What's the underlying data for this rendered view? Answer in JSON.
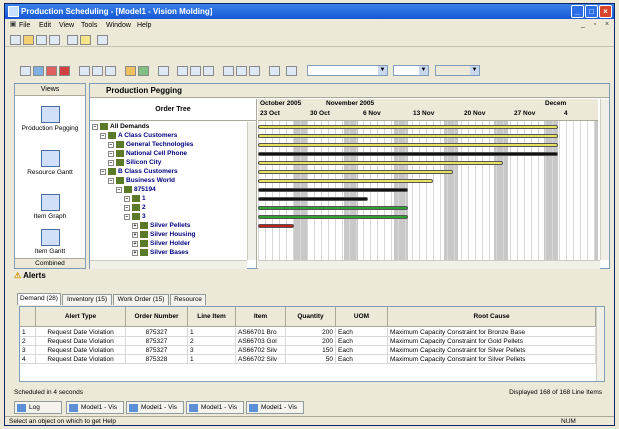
{
  "window": {
    "title": "Production Scheduling - [Model1 - Vision Molding]"
  },
  "menu": [
    "File",
    "Edit",
    "View",
    "Tools",
    "Window",
    "Help"
  ],
  "views": {
    "header": "Views",
    "items": [
      "Production Pegging",
      "Resource Gantt",
      "Item Graph",
      "Item Gantt"
    ],
    "footer": "Combined"
  },
  "pegging": {
    "title": "Production Pegging",
    "tree_header": "Order Tree",
    "tree": [
      {
        "label": "All Demands",
        "level": 0
      },
      {
        "label": "A Class Customers",
        "level": 1
      },
      {
        "label": "General Technologies",
        "level": 2
      },
      {
        "label": "National Cell Phone",
        "level": 2
      },
      {
        "label": "Silicon City",
        "level": 2
      },
      {
        "label": "B Class Customers",
        "level": 1
      },
      {
        "label": "Business World",
        "level": 2
      },
      {
        "label": "875194",
        "level": 3
      },
      {
        "label": "1",
        "level": 4
      },
      {
        "label": "2",
        "level": 4
      },
      {
        "label": "3",
        "level": 4
      },
      {
        "label": "Silver Pellets",
        "level": 5
      },
      {
        "label": "Silver Housing",
        "level": 5
      },
      {
        "label": "Silver Holder",
        "level": 5
      },
      {
        "label": "Silver Bases",
        "level": 5
      }
    ],
    "months": [
      "October 2005",
      "November 2005",
      "Decem"
    ],
    "weeks": [
      "23 Oct",
      "30 Oct",
      "6 Nov",
      "13 Nov",
      "20 Nov",
      "27 Nov",
      "4"
    ]
  },
  "alerts": {
    "title": "Alerts",
    "tabs": [
      "Demand (28)",
      "Inventory (15)",
      "Work Order (15)",
      "Resource"
    ],
    "columns": [
      "Alert Type",
      "Order Number",
      "Line Item",
      "Item",
      "Quantity",
      "UOM",
      "Root Cause"
    ],
    "rows": [
      {
        "n": "1",
        "type": "Request Date Violation",
        "order": "875327",
        "line": "1",
        "item": "AS66701 Bro",
        "qty": "200",
        "uom": "Each",
        "cause": "Maximum Capacity Constraint for Bronze Base"
      },
      {
        "n": "2",
        "type": "Request Date Violation",
        "order": "875327",
        "line": "2",
        "item": "AS66703 Gol",
        "qty": "200",
        "uom": "Each",
        "cause": "Maximum Capacity Constraint for Gold Pellets"
      },
      {
        "n": "3",
        "type": "Request Date Violation",
        "order": "875327",
        "line": "3",
        "item": "AS66702 Silv",
        "qty": "150",
        "uom": "Each",
        "cause": "Maximum Capacity Constraint for Silver Pellets"
      },
      {
        "n": "4",
        "type": "Request Date Violation",
        "order": "875328",
        "line": "1",
        "item": "AS66702 Silv",
        "qty": "50",
        "uom": "Each",
        "cause": "Maximum Capacity Constraint for Silver Pellets"
      }
    ]
  },
  "status": {
    "left": "Scheduled in 4 seconds",
    "right": "Displayed 168 of 168 Line Items"
  },
  "tasks": [
    "Log",
    "Model1 - Vis",
    "Model1 - Vis",
    "Model1 - Vis",
    "Model1 - Vis"
  ],
  "bottom": {
    "help": "Select an object on which to get Help",
    "num": "NUM"
  },
  "colors": {
    "gantt_yellow": "#e8e060",
    "gantt_green": "#30a030",
    "gantt_black": "#101010",
    "gantt_red": "#c02020"
  }
}
